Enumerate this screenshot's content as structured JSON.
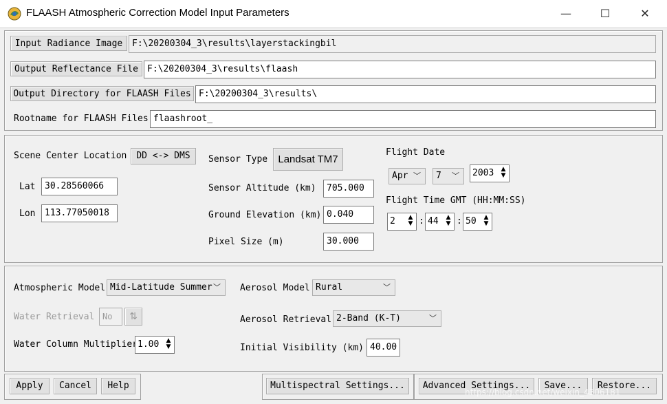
{
  "window": {
    "title": "FLAASH Atmospheric Correction Model Input Parameters",
    "minimize": "—",
    "maximize": "☐",
    "close": "✕"
  },
  "files": {
    "input_radiance_label": "Input Radiance Image",
    "input_radiance_value": "F:\\20200304_3\\results\\layerstackingbil",
    "output_reflectance_label": "Output Reflectance File",
    "output_reflectance_value": "F:\\20200304_3\\results\\flaash",
    "output_directory_label": "Output Directory for FLAASH Files",
    "output_directory_value": "F:\\20200304_3\\results\\",
    "rootname_label": "Rootname for FLAASH Files",
    "rootname_value": "flaashroot_"
  },
  "scene": {
    "location_label": "Scene Center Location",
    "dd_dms_button": "DD <-> DMS",
    "lat_label": "Lat",
    "lat_value": "30.28560066",
    "lon_label": "Lon",
    "lon_value": "113.77050018",
    "sensor_type_label": "Sensor Type",
    "sensor_type_value": "Landsat TM7",
    "sensor_altitude_label": "Sensor Altitude (km)",
    "sensor_altitude_value": "705.000",
    "ground_elevation_label": "Ground Elevation (km)",
    "ground_elevation_value": "0.040",
    "pixel_size_label": "Pixel Size (m)",
    "pixel_size_value": "30.000",
    "flight_date_label": "Flight Date",
    "month": "Apr",
    "day": "7",
    "year": "2003",
    "flight_time_label": "Flight Time GMT (HH:MM:SS)",
    "hour": "2",
    "minute": "44",
    "second": "50",
    "colon": ":"
  },
  "atmosphere": {
    "model_label": "Atmospheric Model",
    "model_value": "Mid-Latitude Summer",
    "water_retrieval_label": "Water Retrieval",
    "water_retrieval_value": "No",
    "water_column_label": "Water Column Multiplier",
    "water_column_value": "1.00",
    "aerosol_model_label": "Aerosol Model",
    "aerosol_model_value": "Rural",
    "aerosol_retrieval_label": "Aerosol Retrieval",
    "aerosol_retrieval_value": "2-Band (K-T)",
    "initial_visibility_label": "Initial Visibility (km)",
    "initial_visibility_value": "40.00"
  },
  "footer": {
    "apply": "Apply",
    "cancel": "Cancel",
    "help": "Help",
    "multispectral": "Multispectral Settings...",
    "advanced": "Advanced Settings...",
    "save": "Save...",
    "restore": "Restore...",
    "watermark": "https://blog.csdn.net/weixin_4306181"
  }
}
